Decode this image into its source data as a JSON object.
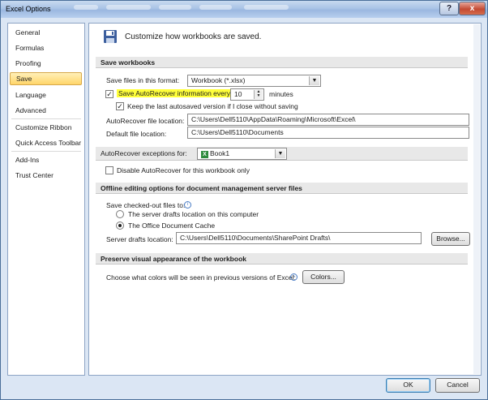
{
  "window": {
    "title": "Excel Options",
    "help_icon": "?",
    "close_icon": "x"
  },
  "sidebar": {
    "items": [
      {
        "label": "General"
      },
      {
        "label": "Formulas"
      },
      {
        "label": "Proofing"
      },
      {
        "label": "Save",
        "selected": true
      },
      {
        "label": "Language"
      },
      {
        "label": "Advanced"
      },
      {
        "label": "Customize Ribbon"
      },
      {
        "label": "Quick Access Toolbar"
      },
      {
        "label": "Add-Ins"
      },
      {
        "label": "Trust Center"
      }
    ]
  },
  "header": {
    "text": "Customize how workbooks are saved.",
    "icon": "save-icon"
  },
  "save_workbooks": {
    "title": "Save workbooks",
    "format_label": "Save files in this format:",
    "format_value": "Workbook (*.xlsx)",
    "autorecover_label": "Save AutoRecover information every",
    "autorecover_checked": true,
    "autorecover_minutes": "10",
    "minutes_label": "minutes",
    "keep_label": "Keep the last autosaved version if I close without saving",
    "keep_checked": true,
    "ar_location_label": "AutoRecover file location:",
    "ar_location_value": "C:\\Users\\Dell5110\\AppData\\Roaming\\Microsoft\\Excel\\",
    "default_location_label": "Default file location:",
    "default_location_value": "C:\\Users\\Dell5110\\Documents"
  },
  "exceptions": {
    "label": "AutoRecover exceptions for:",
    "workbook": "Book1",
    "disable_label": "Disable AutoRecover for this workbook only",
    "disable_checked": false
  },
  "offline": {
    "title": "Offline editing options for document management server files",
    "checked_out_label": "Save checked-out files to:",
    "option1": "The server drafts location on this computer",
    "option2": "The Office Document Cache",
    "selected_option": 2,
    "drafts_label": "Server drafts location:",
    "drafts_value": "C:\\Users\\Dell5110\\Documents\\SharePoint Drafts\\",
    "browse": "Browse..."
  },
  "preserve": {
    "title": "Preserve visual appearance of the workbook",
    "colors_label": "Choose what colors will be seen in previous versions of Excel:",
    "colors_button": "Colors..."
  },
  "footer": {
    "ok": "OK",
    "cancel": "Cancel"
  },
  "colors": {
    "highlight": "#ffff3a",
    "selected_nav": "#ffd56a",
    "titlebar": "#a9c3e6"
  }
}
